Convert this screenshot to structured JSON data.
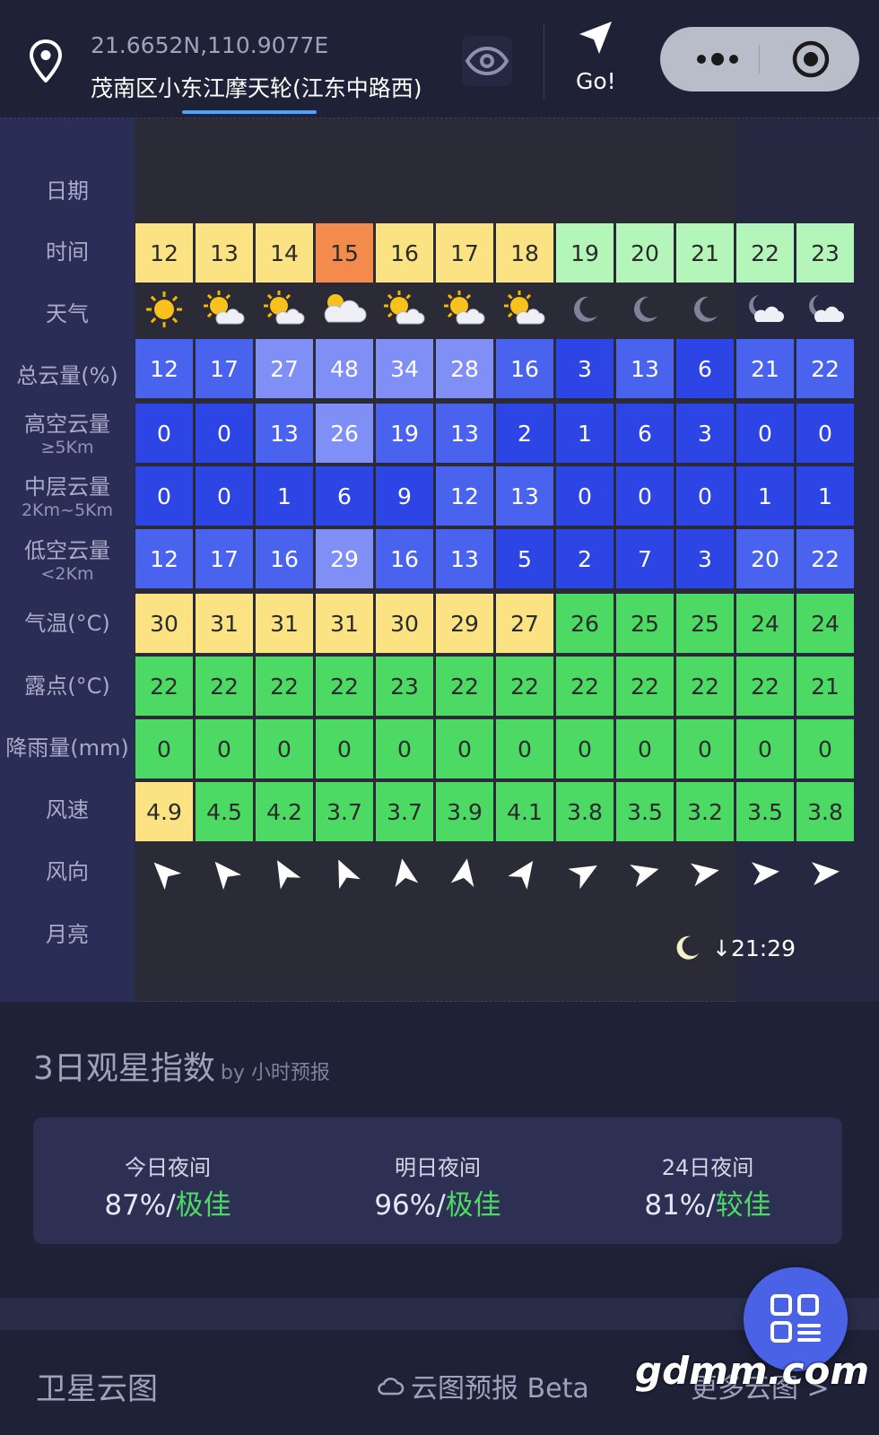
{
  "header": {
    "coords": "21.6652N,110.9077E",
    "address": "茂南区小东江摩天轮(江东中路西)",
    "go_label": "Go!"
  },
  "row_labels": {
    "date": "日期",
    "time": "时间",
    "weather": "天气",
    "total_cloud": "总云量(%)",
    "high_cloud": "高空云量",
    "high_cloud_sub": "≥5Km",
    "mid_cloud": "中层云量",
    "mid_cloud_sub": "2Km~5Km",
    "low_cloud": "低空云量",
    "low_cloud_sub": "<2Km",
    "temp": "气温(°C)",
    "dew": "露点(°C)",
    "rain": "降雨量(mm)",
    "wind_speed": "风速",
    "wind_dir": "风向",
    "moon": "月亮"
  },
  "hours": [
    "12",
    "13",
    "14",
    "15",
    "16",
    "17",
    "18",
    "19",
    "20",
    "21",
    "22",
    "23"
  ],
  "weather_icons": [
    "sun-icon",
    "sun-cloud-icon",
    "sun-cloud-icon",
    "cloud-sun-icon",
    "sun-cloud-icon",
    "sun-cloud-icon",
    "sun-cloud-icon",
    "moon-icon",
    "moon-icon",
    "moon-icon",
    "moon-cloud-icon",
    "moon-cloud-icon"
  ],
  "total_cloud": [
    "12",
    "17",
    "27",
    "48",
    "34",
    "28",
    "16",
    "3",
    "13",
    "6",
    "21",
    "22"
  ],
  "high_cloud": [
    "0",
    "0",
    "13",
    "26",
    "19",
    "13",
    "2",
    "1",
    "6",
    "3",
    "0",
    "0"
  ],
  "mid_cloud": [
    "0",
    "0",
    "1",
    "6",
    "9",
    "12",
    "13",
    "0",
    "0",
    "0",
    "1",
    "1"
  ],
  "low_cloud": [
    "12",
    "17",
    "16",
    "29",
    "16",
    "13",
    "5",
    "2",
    "7",
    "3",
    "20",
    "22"
  ],
  "temp": [
    "30",
    "31",
    "31",
    "31",
    "30",
    "29",
    "27",
    "26",
    "25",
    "25",
    "24",
    "24"
  ],
  "dew": [
    "22",
    "22",
    "22",
    "22",
    "23",
    "22",
    "22",
    "22",
    "22",
    "22",
    "22",
    "21"
  ],
  "rain": [
    "0",
    "0",
    "0",
    "0",
    "0",
    "0",
    "0",
    "0",
    "0",
    "0",
    "0",
    "0"
  ],
  "wind_speed": [
    "4.9",
    "4.5",
    "4.2",
    "3.7",
    "3.7",
    "3.9",
    "4.1",
    "3.8",
    "3.5",
    "3.2",
    "3.5",
    "3.8"
  ],
  "wind_dir_deg": [
    -45,
    -40,
    -30,
    -25,
    -10,
    10,
    35,
    60,
    75,
    80,
    85,
    85
  ],
  "moon_set": "↓21:29",
  "stargazing": {
    "title": "3日观星指数",
    "by": "by 小时预报",
    "days": [
      {
        "label": "今日夜间",
        "percent": "87%/",
        "quality": "极佳"
      },
      {
        "label": "明日夜间",
        "percent": "96%/",
        "quality": "极佳"
      },
      {
        "label": "24日夜间",
        "percent": "81%/",
        "quality": "较佳"
      }
    ]
  },
  "footer": {
    "title": "卫星云图",
    "cloud_pred": "云图预报 Beta",
    "more": "更多云图 >"
  },
  "watermark": "gdmm.com",
  "colors": {
    "hour_day": "#fbe383",
    "hour_now": "#f28b4c",
    "hour_night": "#b4f5b9",
    "green": "#4cd964",
    "yellow": "#fbe383",
    "blue_dark": "#2e45e6",
    "blue_mid": "#4a63ef",
    "blue_light": "#7f8ff5"
  }
}
